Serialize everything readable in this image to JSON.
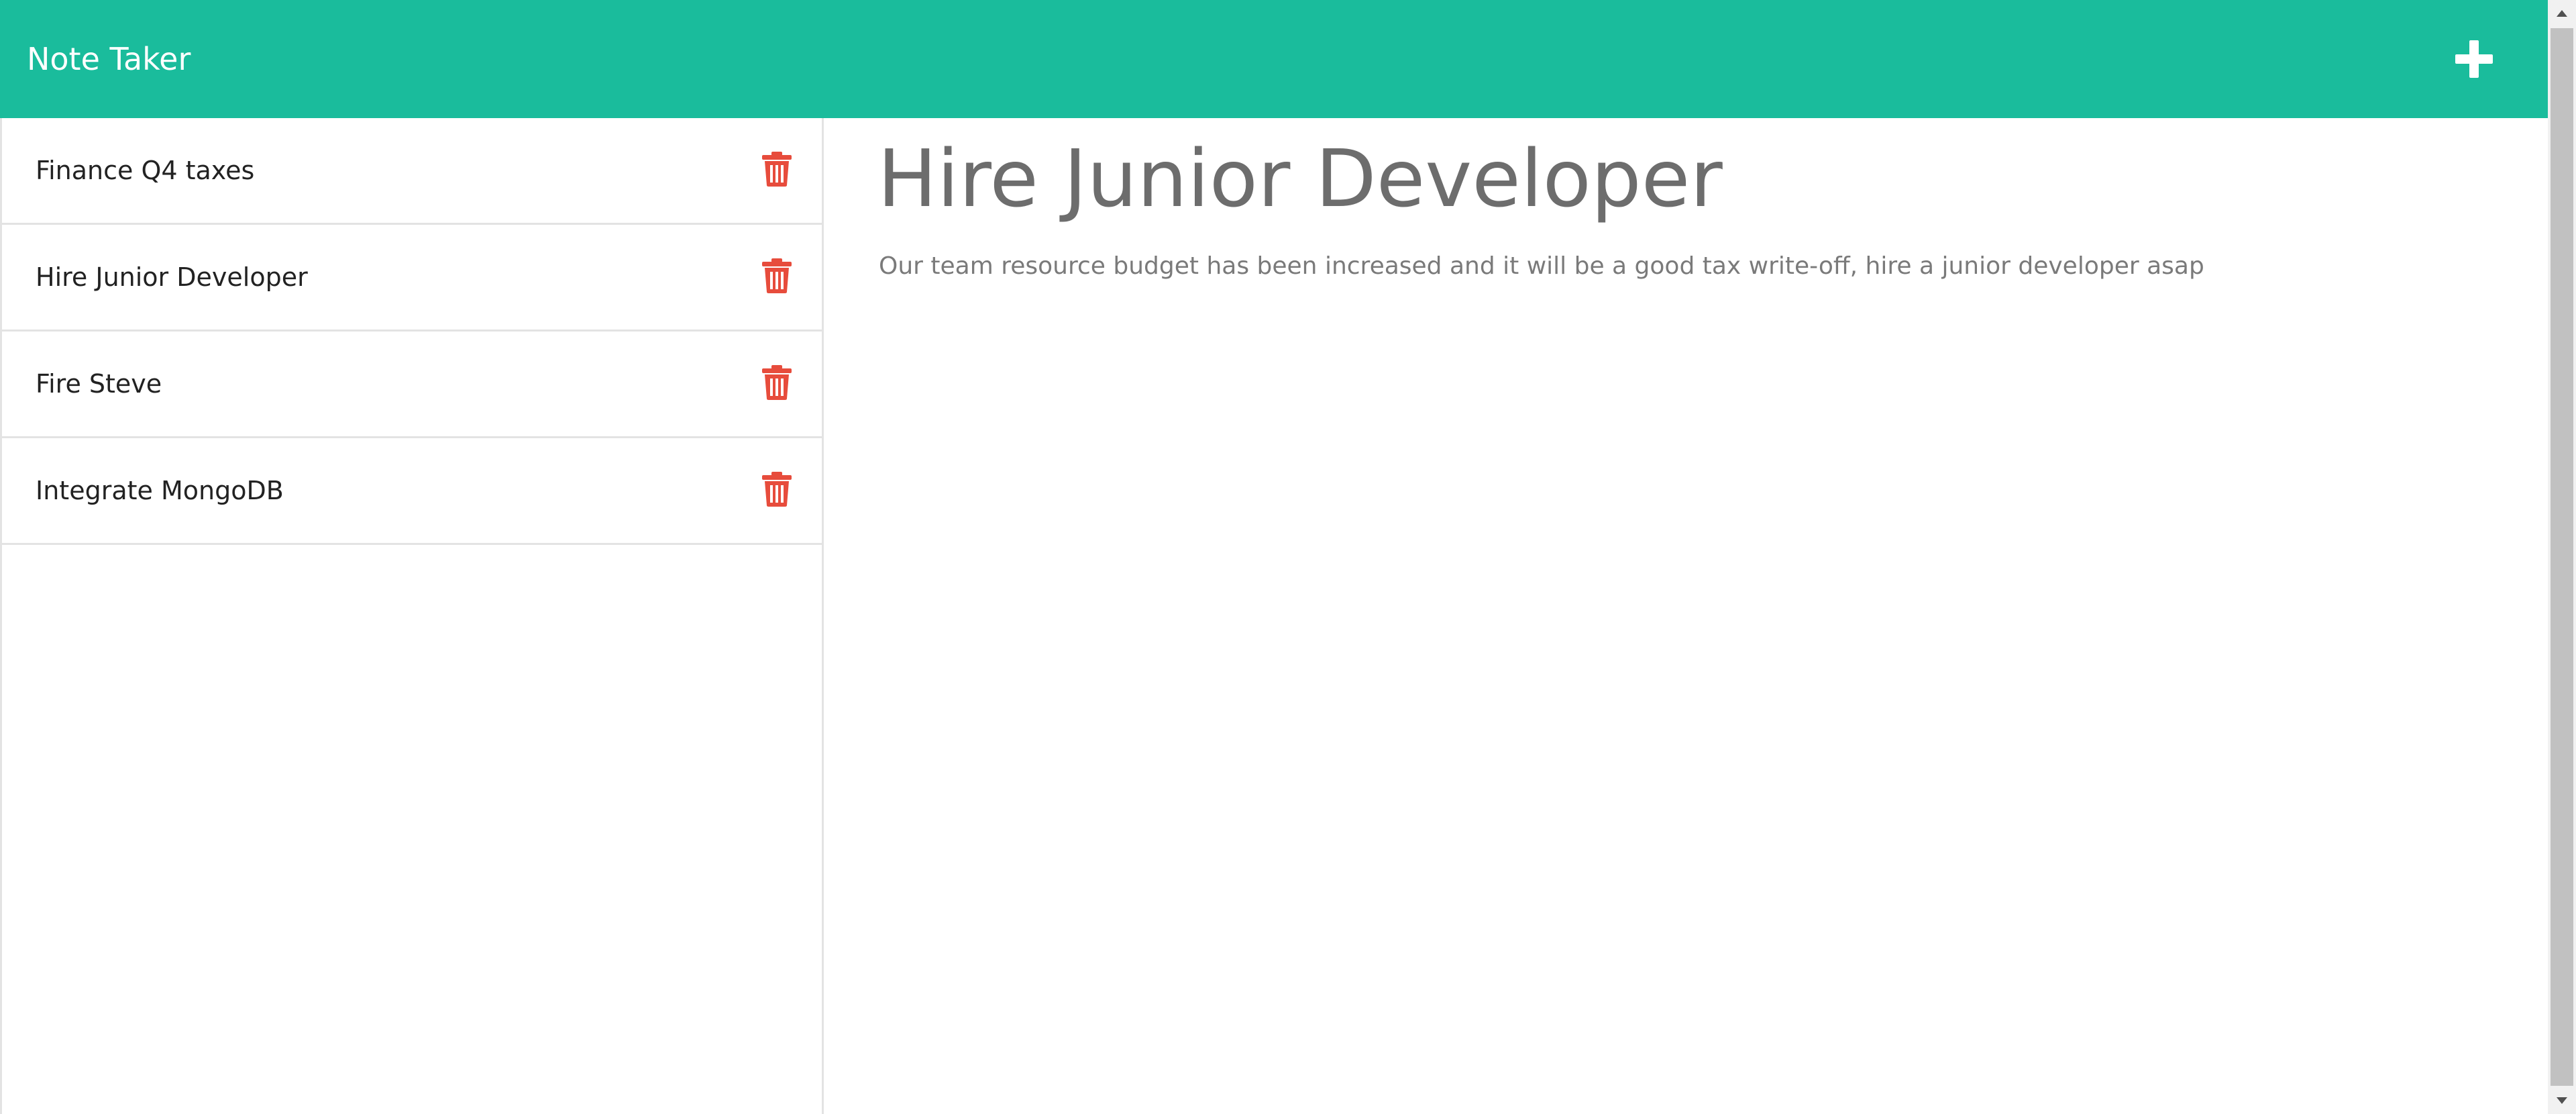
{
  "navbar": {
    "title": "Note Taker",
    "new_note_icon": "plus-icon",
    "background_color": "#1abc9c"
  },
  "sidebar": {
    "notes": [
      {
        "title": "Finance Q4 taxes",
        "delete_icon": "trash-icon"
      },
      {
        "title": "Hire Junior Developer",
        "delete_icon": "trash-icon"
      },
      {
        "title": "Fire Steve",
        "delete_icon": "trash-icon"
      },
      {
        "title": "Integrate MongoDB",
        "delete_icon": "trash-icon"
      }
    ],
    "delete_color": "#e74c3c"
  },
  "editor": {
    "title": "Hire Junior Developer",
    "text": "Our team resource budget has been increased and it will be a good tax write-off, hire a junior developer asap"
  },
  "scrollbar": {
    "up_icon": "arrow-up-icon",
    "down_icon": "arrow-down-icon"
  }
}
